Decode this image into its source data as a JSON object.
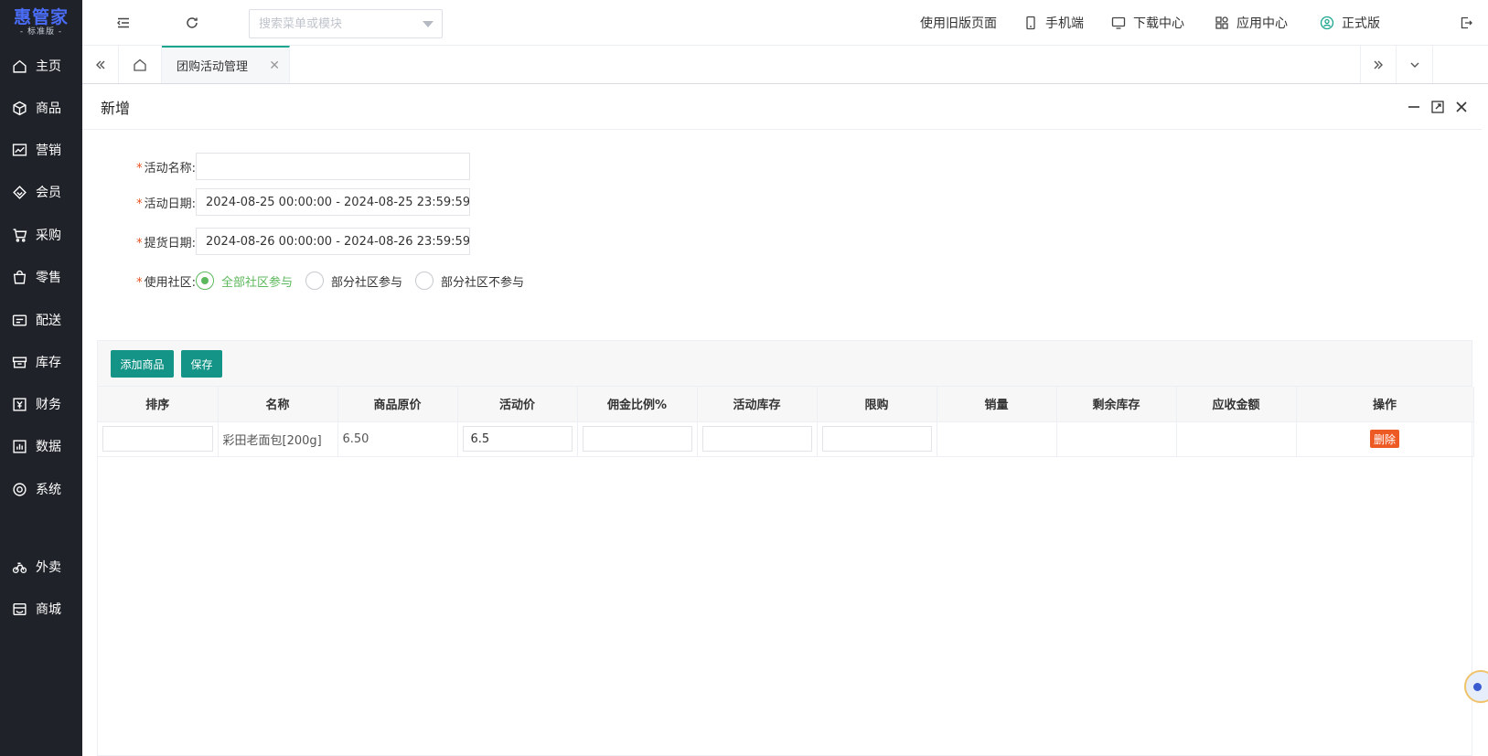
{
  "sidebar": {
    "logo_main": "惠管家",
    "logo_sub": "- 标准版 -",
    "items": [
      {
        "label": "主页",
        "icon": "home-icon"
      },
      {
        "label": "商品",
        "icon": "cube-icon"
      },
      {
        "label": "营销",
        "icon": "trend-chart-icon"
      },
      {
        "label": "会员",
        "icon": "diamond-icon"
      },
      {
        "label": "采购",
        "icon": "cart-icon"
      },
      {
        "label": "零售",
        "icon": "shopping-bag-icon"
      },
      {
        "label": "配送",
        "icon": "delivery-icon"
      },
      {
        "label": "库存",
        "icon": "box-icon"
      },
      {
        "label": "财务",
        "icon": "finance-icon"
      },
      {
        "label": "数据",
        "icon": "bar-chart-icon"
      },
      {
        "label": "系统",
        "icon": "settings-icon"
      },
      {
        "label": "外卖",
        "icon": "bike-icon"
      },
      {
        "label": "商城",
        "icon": "store-icon"
      }
    ]
  },
  "topbar": {
    "search_placeholder": "搜索菜单或模块",
    "links": {
      "old_version": "使用旧版页面",
      "mobile": "手机端",
      "download": "下载中心",
      "apps": "应用中心",
      "edition": "正式版"
    }
  },
  "tabs": {
    "active_label": "团购活动管理"
  },
  "panel": {
    "title": "新增",
    "form": {
      "name_label": "活动名称:",
      "name_value": "",
      "date_label": "活动日期:",
      "date_value": "2024-08-25 00:00:00 - 2024-08-25 23:59:59",
      "pickup_label": "提货日期:",
      "pickup_value": "2024-08-26 00:00:00 - 2024-08-26 23:59:59",
      "community_label": "使用社区:",
      "community_options": [
        "全部社区参与",
        "部分社区参与",
        "部分社区不参与"
      ],
      "community_selected": "全部社区参与"
    },
    "toolbar": {
      "add_product": "添加商品",
      "save": "保存"
    },
    "table": {
      "columns": [
        "排序",
        "名称",
        "商品原价",
        "活动价",
        "佣金比例%",
        "活动库存",
        "限购",
        "销量",
        "剩余库存",
        "应收金额",
        "操作"
      ],
      "rows": [
        {
          "sort": "",
          "name": "彩田老面包[200g]",
          "original_price": "6.50",
          "activity_price": "6.5",
          "commission": "",
          "activity_stock": "",
          "limit": "",
          "sales": "",
          "remaining_stock": "",
          "receivable": "",
          "action": "删除"
        }
      ]
    }
  },
  "colors": {
    "sidebar_bg": "#1f2329",
    "accent": "#139486",
    "radio_checked": "#5cb85c",
    "required": "#e5511e",
    "delete": "#ee5a24",
    "logo": "#4a6cf7"
  }
}
